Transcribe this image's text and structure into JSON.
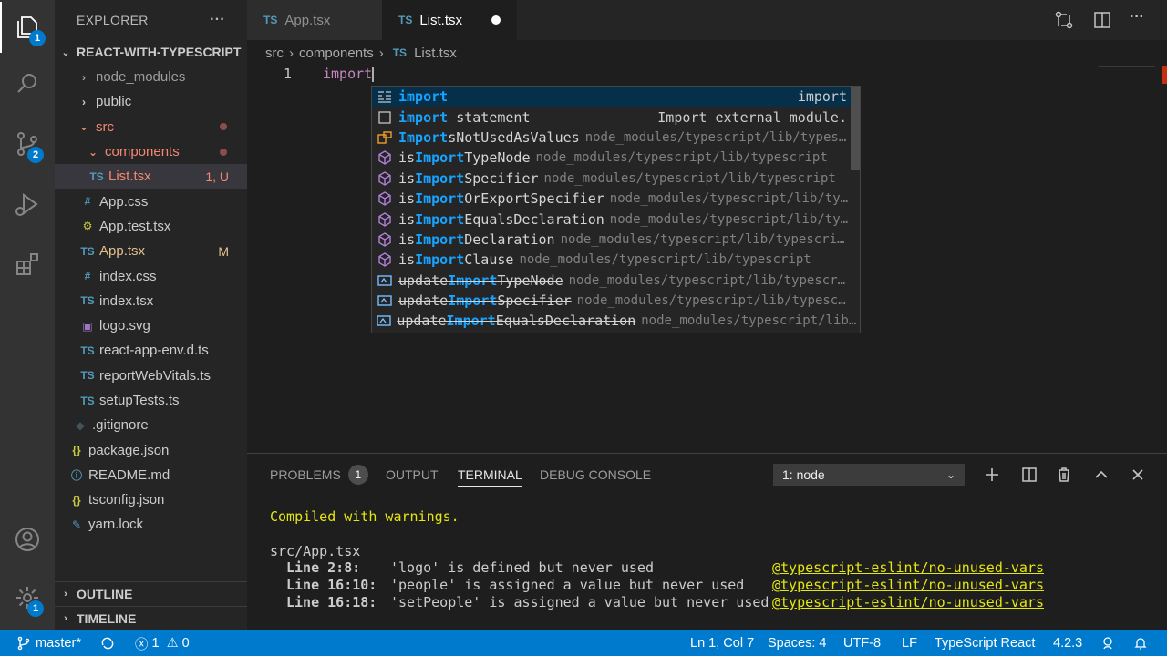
{
  "activity": {
    "explorer_badge": "1",
    "scm_badge": "2",
    "settings_badge": "1"
  },
  "sidebar": {
    "title": "EXPLORER",
    "more": "···",
    "project": "REACT-WITH-TYPESCRIPT",
    "items": [
      {
        "label": "node_modules",
        "icon": "chevron-right",
        "depth": 1
      },
      {
        "label": "public",
        "icon": "chevron-right",
        "depth": 1
      },
      {
        "label": "src",
        "icon": "chevron-down",
        "depth": 1
      },
      {
        "label": "components",
        "icon": "chevron-down",
        "depth": 2
      },
      {
        "label": "List.tsx",
        "icon": "TS",
        "decor": "1, U",
        "depth": 3
      },
      {
        "label": "App.css",
        "icon": "#",
        "depth": 2
      },
      {
        "label": "App.test.tsx",
        "icon": "gear",
        "depth": 2
      },
      {
        "label": "App.tsx",
        "icon": "TS",
        "decor": "M",
        "depth": 2
      },
      {
        "label": "index.css",
        "icon": "#",
        "depth": 2
      },
      {
        "label": "index.tsx",
        "icon": "TS",
        "depth": 2
      },
      {
        "label": "logo.svg",
        "icon": "image",
        "depth": 2
      },
      {
        "label": "react-app-env.d.ts",
        "icon": "TS",
        "depth": 2
      },
      {
        "label": "reportWebVitals.ts",
        "icon": "TS",
        "depth": 2
      },
      {
        "label": "setupTests.ts",
        "icon": "TS",
        "depth": 2
      },
      {
        "label": ".gitignore",
        "icon": "git",
        "depth": 1
      },
      {
        "label": "package.json",
        "icon": "{}",
        "depth": 1
      },
      {
        "label": "README.md",
        "icon": "info",
        "depth": 1
      },
      {
        "label": "tsconfig.json",
        "icon": "{}",
        "depth": 1
      },
      {
        "label": "yarn.lock",
        "icon": "yarn",
        "depth": 1
      }
    ],
    "outline": "OUTLINE",
    "timeline": "TIMELINE"
  },
  "tabs": [
    {
      "label": "App.tsx",
      "icon": "TS",
      "active": false
    },
    {
      "label": "List.tsx",
      "icon": "TS",
      "active": true,
      "dirty": true
    }
  ],
  "breadcrumb": {
    "part1": "src",
    "part2": "components",
    "icon": "TS",
    "part3": "List.tsx"
  },
  "editor": {
    "line_number": "1",
    "code": "import"
  },
  "suggest": [
    {
      "hl": "import",
      "rest": "",
      "detail": "",
      "right": "import",
      "kind": "keyword"
    },
    {
      "hl": "import",
      "rest": " statement",
      "detail": "",
      "right": "Import external module.",
      "kind": "snippet"
    },
    {
      "pre": "",
      "hl": "Import",
      "rest": "sNotUsedAsValues",
      "detail": "node_modules/typescript/lib/types…",
      "kind": "enum"
    },
    {
      "pre": "is",
      "hl": "Import",
      "rest": "TypeNode",
      "detail": "node_modules/typescript/lib/typescript",
      "kind": "method"
    },
    {
      "pre": "is",
      "hl": "Import",
      "rest": "Specifier",
      "detail": "node_modules/typescript/lib/typescript",
      "kind": "method"
    },
    {
      "pre": "is",
      "hl": "Import",
      "rest": "OrExportSpecifier",
      "detail": "node_modules/typescript/lib/ty…",
      "kind": "method"
    },
    {
      "pre": "is",
      "hl": "Import",
      "rest": "EqualsDeclaration",
      "detail": "node_modules/typescript/lib/ty…",
      "kind": "method"
    },
    {
      "pre": "is",
      "hl": "Import",
      "rest": "Declaration",
      "detail": "node_modules/typescript/lib/typescri…",
      "kind": "method"
    },
    {
      "pre": "is",
      "hl": "Import",
      "rest": "Clause",
      "detail": "node_modules/typescript/lib/typescript",
      "kind": "method"
    },
    {
      "pre": "update",
      "hl": "Import",
      "rest": "TypeNode",
      "detail": "node_modules/typescript/lib/typescr…",
      "kind": "variable",
      "deprecated": true
    },
    {
      "pre": "update",
      "hl": "Import",
      "rest": "Specifier",
      "detail": "node_modules/typescript/lib/typesc…",
      "kind": "variable",
      "deprecated": true
    },
    {
      "pre": "update",
      "hl": "Import",
      "rest": "EqualsDeclaration",
      "detail": "node_modules/typescript/lib/li…",
      "kind": "variable",
      "deprecated": true
    }
  ],
  "panel": {
    "problems": "PROBLEMS",
    "problems_count": "1",
    "output": "OUTPUT",
    "terminal": "TERMINAL",
    "debug": "DEBUG CONSOLE",
    "terminal_select": "1: node",
    "lines": {
      "compiled": "Compiled with warnings.",
      "file": "src/App.tsx",
      "w1_loc": "Line 2:8:",
      "w1_msg": "'logo' is defined but never used",
      "w2_loc": "Line 16:10:",
      "w2_msg": "'people' is assigned a value but never used",
      "w3_loc": "Line 16:18:",
      "w3_msg": "'setPeople' is assigned a value but never used",
      "rule": "@typescript-eslint/no-unused-vars"
    }
  },
  "status": {
    "branch": "master*",
    "errors": "1",
    "warnings": "0",
    "position": "Ln 1, Col 7",
    "spaces": "Spaces: 4",
    "encoding": "UTF-8",
    "eol": "LF",
    "language": "TypeScript React",
    "version": "4.2.3"
  },
  "colors": {
    "accent": "#007acc",
    "ts": "#519aba",
    "highlight": "#18a3ff",
    "warning_rule": "#e5e510"
  }
}
